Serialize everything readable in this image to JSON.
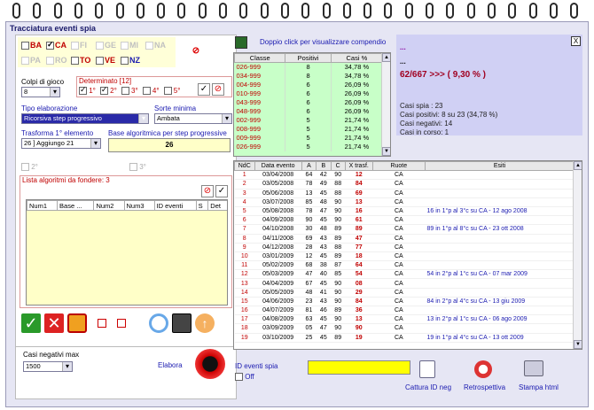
{
  "window": {
    "title": "Tracciatura eventi spia",
    "close_label": "X"
  },
  "regions": [
    {
      "code": "BA",
      "checked": false,
      "enabled": true
    },
    {
      "code": "CA",
      "checked": true,
      "enabled": true
    },
    {
      "code": "FI",
      "checked": false,
      "enabled": false
    },
    {
      "code": "GE",
      "checked": false,
      "enabled": false
    },
    {
      "code": "MI",
      "checked": false,
      "enabled": false
    },
    {
      "code": "NA",
      "checked": false,
      "enabled": false
    },
    {
      "code": "PA",
      "checked": false,
      "enabled": false
    },
    {
      "code": "RO",
      "checked": false,
      "enabled": false
    },
    {
      "code": "TO",
      "checked": false,
      "enabled": true
    },
    {
      "code": "VE",
      "checked": false,
      "enabled": true
    },
    {
      "code": "NZ",
      "checked": false,
      "enabled": true
    }
  ],
  "colpi": {
    "label": "Colpi di gioco",
    "value": "8"
  },
  "determinato": {
    "label": "Determinato [12]",
    "items": [
      {
        "label": "1°",
        "checked": true
      },
      {
        "label": "2°",
        "checked": true
      },
      {
        "label": "3°",
        "checked": false
      },
      {
        "label": "4°",
        "checked": false
      },
      {
        "label": "5°",
        "checked": false
      }
    ]
  },
  "tipo": {
    "label": "Tipo elaborazione",
    "value": "Ricorsiva step progressivo"
  },
  "sorte": {
    "label": "Sorte minima",
    "value": "Ambata"
  },
  "trasforma": {
    "label": "Trasforma 1° elemento",
    "value": "26 ] Aggiungo 21"
  },
  "base": {
    "label": "Base algoritmica per step progressive",
    "value": "26"
  },
  "opt2": "2°",
  "opt3": "3°",
  "lista": {
    "label": "Lista algoritmi da fondere: 3",
    "columns": [
      "Num1",
      "Base ...",
      "Num2",
      "Num3",
      "ID eventi",
      "S",
      "Det"
    ]
  },
  "casi_neg": {
    "label": "Casi negativi max",
    "value": "1500"
  },
  "elabora": "Elabora",
  "doppio": "Doppio click per visualizzare compendio",
  "classes": {
    "columns": [
      "Classe",
      "Positivi",
      "Casi %"
    ],
    "rows": [
      [
        "026-999",
        "8",
        "34,78 %"
      ],
      [
        "034-999",
        "8",
        "34,78 %"
      ],
      [
        "004-999",
        "6",
        "26,09 %"
      ],
      [
        "010-999",
        "6",
        "26,09 %"
      ],
      [
        "043-999",
        "6",
        "26,09 %"
      ],
      [
        "048-999",
        "6",
        "26,09 %"
      ],
      [
        "002-999",
        "5",
        "21,74 %"
      ],
      [
        "008-999",
        "5",
        "21,74 %"
      ],
      [
        "009-999",
        "5",
        "21,74 %"
      ],
      [
        "026-999",
        "5",
        "21,74 %"
      ]
    ]
  },
  "summary": {
    "dots1": "...",
    "dots2": "...",
    "ratio": "62/667 >>> ( 9,30 % )",
    "casi_spia": "Casi spia : 23",
    "casi_pos": "Casi positivi: 8 su 23 (34,78 %)",
    "casi_neg": "Casi negativi: 14",
    "casi_corso": "Casi in corso: 1"
  },
  "events": {
    "columns": [
      "NdC",
      "Data evento",
      "A",
      "B",
      "C",
      "X trasf.",
      "Ruote",
      "Esiti"
    ],
    "rows": [
      [
        "1",
        "03/04/2008",
        "64",
        "42",
        "90",
        "12",
        "CA",
        ""
      ],
      [
        "2",
        "03/05/2008",
        "78",
        "49",
        "88",
        "84",
        "CA",
        ""
      ],
      [
        "3",
        "05/06/2008",
        "13",
        "45",
        "88",
        "69",
        "CA",
        ""
      ],
      [
        "4",
        "03/07/2008",
        "85",
        "48",
        "90",
        "13",
        "CA",
        ""
      ],
      [
        "5",
        "05/08/2008",
        "78",
        "47",
        "90",
        "16",
        "CA",
        "16 in 1°p al 3°c su CA - 12 ago 2008"
      ],
      [
        "6",
        "04/09/2008",
        "90",
        "45",
        "90",
        "61",
        "CA",
        ""
      ],
      [
        "7",
        "04/10/2008",
        "30",
        "48",
        "89",
        "89",
        "CA",
        "89 in 1°p al 8°c su CA - 23 ott 2008"
      ],
      [
        "8",
        "04/11/2008",
        "69",
        "43",
        "89",
        "47",
        "CA",
        ""
      ],
      [
        "9",
        "04/12/2008",
        "28",
        "43",
        "88",
        "77",
        "CA",
        ""
      ],
      [
        "10",
        "03/01/2009",
        "12",
        "45",
        "89",
        "18",
        "CA",
        ""
      ],
      [
        "11",
        "05/02/2009",
        "68",
        "38",
        "87",
        "64",
        "CA",
        ""
      ],
      [
        "12",
        "05/03/2009",
        "47",
        "40",
        "85",
        "54",
        "CA",
        "54 in 2°p al 1°c su CA - 07 mar 2009"
      ],
      [
        "13",
        "04/04/2009",
        "67",
        "45",
        "90",
        "08",
        "CA",
        ""
      ],
      [
        "14",
        "05/05/2009",
        "48",
        "41",
        "90",
        "29",
        "CA",
        ""
      ],
      [
        "15",
        "04/06/2009",
        "23",
        "43",
        "90",
        "84",
        "CA",
        "84 in 2°p al 4°c su CA - 13 giu 2009"
      ],
      [
        "16",
        "04/07/2009",
        "81",
        "46",
        "89",
        "36",
        "CA",
        ""
      ],
      [
        "17",
        "04/08/2009",
        "63",
        "45",
        "90",
        "13",
        "CA",
        "13 in 2°p al 1°c su CA - 06 ago 2009"
      ],
      [
        "18",
        "03/09/2009",
        "05",
        "47",
        "90",
        "90",
        "CA",
        ""
      ],
      [
        "19",
        "03/10/2009",
        "25",
        "45",
        "89",
        "19",
        "CA",
        "19 in 1°p al 4°c su CA - 13 ott 2009"
      ]
    ]
  },
  "id_spia": {
    "label": "ID eventi spia",
    "off_label": "Off",
    "value": ""
  },
  "buttons": {
    "cattura": "Cattura ID neg",
    "retro": "Retrospettiva",
    "stampa": "Stampa html"
  },
  "colors": {
    "accent": "#1a1ab0",
    "red": "#c00000",
    "green_table": "#c8ffc8",
    "yellow_field": "#ffff00"
  },
  "icons": [
    "binder-ring-icon",
    "no-entry-icon",
    "check-icon",
    "cross-icon",
    "bucket-icon",
    "refresh-icon",
    "save-icon",
    "up-arrow-icon",
    "power-button-icon",
    "edit-icon",
    "lifebuoy-icon",
    "printer-icon",
    "clipboard-icon"
  ]
}
